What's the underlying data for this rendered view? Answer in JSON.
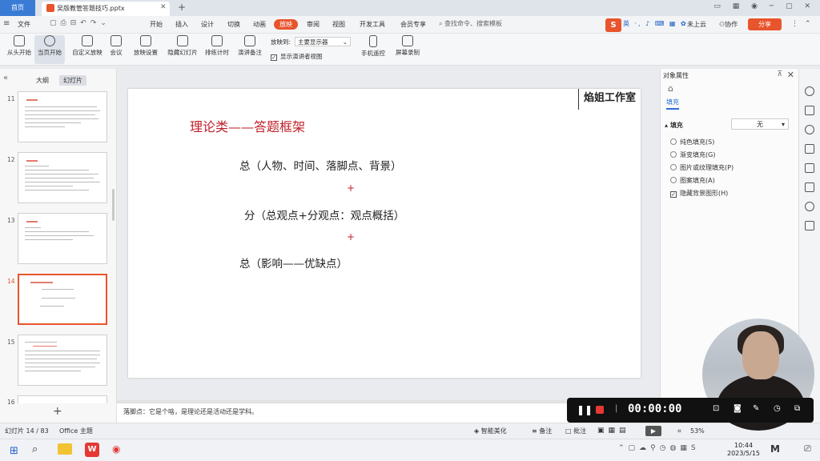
{
  "tabs": {
    "home": "首页",
    "doc": "吴版教管答题技巧.pptx"
  },
  "menu": [
    "文件",
    "开始",
    "插入",
    "设计",
    "切换",
    "动画",
    "放映",
    "审阅",
    "视图",
    "开发工具",
    "会员专享"
  ],
  "search": "查找命令、搜索模板",
  "ime": {
    "logo": "S",
    "lang": "英"
  },
  "toolbar_right": {
    "cloud": "未上云",
    "collab": "协作",
    "share": "分享"
  },
  "ribbon": {
    "from_start": "从头开始",
    "from_current": "当页开始",
    "custom": "自定义放映",
    "meeting": "会议",
    "settings": "放映设置",
    "hide": "隐藏幻灯片",
    "rehearse": "排练计时",
    "record_notes": "演讲备注",
    "play_to_label": "放映到:",
    "play_to_value": "主要显示器",
    "show_presenter": "显示演讲者视图",
    "phone_remote": "手机遥控",
    "screen_record": "屏幕录制"
  },
  "pane_tabs": {
    "outline": "大纲",
    "slides": "幻灯片"
  },
  "thumb_numbers": [
    "11",
    "12",
    "13",
    "14",
    "15",
    "16"
  ],
  "slide": {
    "studio": "焰姐工作室",
    "title": "理论类——答题框架",
    "line1": "总（人物、时间、落脚点、背景）",
    "plus1": "+",
    "line2": "分（总观点+分观点：观点概括）",
    "plus2": "+",
    "line3": "总（影响——优缺点）"
  },
  "notes": "落脚点：它是个啥，是理论还是活动还是学科。",
  "panel": {
    "title": "对象属性",
    "fill_tab": "填充",
    "fill_section": "填充",
    "fill_value": "无",
    "options": [
      "纯色填充(S)",
      "渐变填充(G)",
      "图片或纹理填充(P)",
      "图案填充(A)"
    ],
    "hide_bg": "隐藏背景图形(H)"
  },
  "status": {
    "slide_count": "幻灯片 14 / 83",
    "theme": "Office 主题",
    "smart": "智能美化",
    "notes_btn": "备注",
    "comments": "批注",
    "zoom": "53%"
  },
  "recorder": {
    "timer": "00:00:00"
  },
  "clock": {
    "time": "10:44",
    "date": "2023/5/15"
  }
}
